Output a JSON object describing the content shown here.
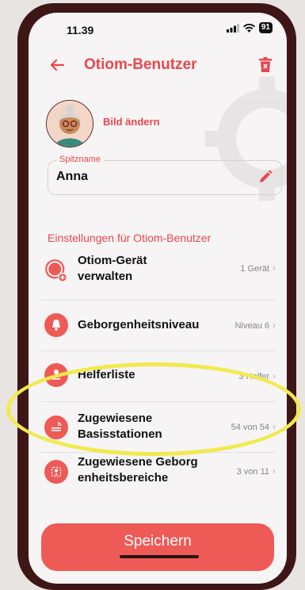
{
  "status_bar": {
    "time": "11.39",
    "battery": "91"
  },
  "header": {
    "title": "Otiom-Benutzer"
  },
  "profile": {
    "change_picture_label": "Bild ändern"
  },
  "nickname": {
    "label": "Spitzname",
    "value": "Anna"
  },
  "section_title": "Einstellungen für Otiom-Benutzer",
  "settings": [
    {
      "label_line1": "Otiom-Gerät",
      "label_line2": "verwalten",
      "value": "1 Gerät",
      "icon": "device-record-icon"
    },
    {
      "label_line1": "Geborgenheitsniveau",
      "label_line2": "",
      "value": "Niveau 6",
      "icon": "bell-icon"
    },
    {
      "label_line1": "Helferliste",
      "label_line2": "",
      "value": "3 Helfer",
      "icon": "person-list-icon"
    },
    {
      "label_line1": "Zugewiesene",
      "label_line2": "Basisstationen",
      "value": "54 von 54",
      "icon": "base-station-icon"
    },
    {
      "label_line1": "Zugewiesene Geborg",
      "label_line2": "enheitsbereiche",
      "value": "3 von 11",
      "icon": "map-area-icon"
    }
  ],
  "save_label": "Speichern",
  "colors": {
    "accent": "#e9474d",
    "highlight": "#f1ea4f",
    "frame": "#3e1616"
  }
}
